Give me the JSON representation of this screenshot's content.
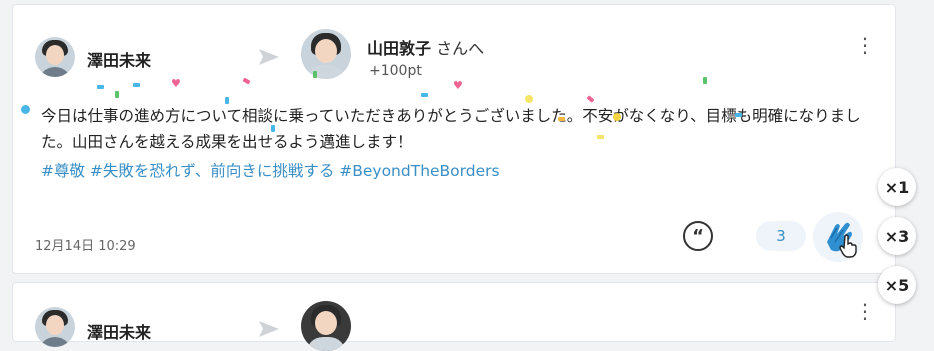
{
  "post": {
    "sender": {
      "name": "澤田未来"
    },
    "recipient": {
      "name": "山田敦子",
      "suffix": " さんへ",
      "points": "+100pt"
    },
    "message": "今日は仕事の進め方について相談に乗っていただきありがとうございました。不安がなくなり、目標も明確になりました。山田さんを越える成果を出せるよう邁進します！",
    "hashtags": "#尊敬 #失敗を恐れず、前向きに挑戦する #BeyondTheBorders",
    "date": "12月14日 10:29",
    "clap_count": "3",
    "quote_symbol": "“",
    "menu_symbol": "⋮"
  },
  "clap_multipliers": [
    "×1",
    "×3",
    "×5"
  ],
  "next_post": {
    "sender_name": "澤田未来",
    "menu_symbol": "⋮"
  },
  "colors": {
    "accent": "#3a8fc6",
    "hashtag": "#3a8fc6",
    "background": "#f2f3f5",
    "card": "#ffffff"
  },
  "icons": [
    "send-arrow-icon",
    "quote-icon",
    "clap-hands-icon",
    "cursor-hand-icon",
    "more-vertical-icon"
  ]
}
